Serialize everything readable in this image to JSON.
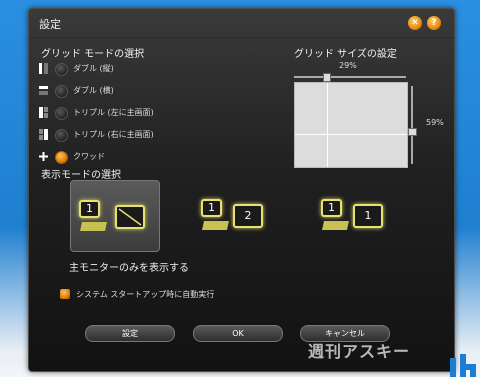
{
  "window": {
    "title": "設定"
  },
  "grid_mode": {
    "heading": "グリッド モードの選択",
    "options": [
      {
        "label": "ダブル (縦)",
        "icon": "grid-double-vertical-icon",
        "selected": false
      },
      {
        "label": "ダブル (横)",
        "icon": "grid-double-horizontal-icon",
        "selected": false
      },
      {
        "label": "トリプル (左に主画面)",
        "icon": "grid-triple-left-icon",
        "selected": false
      },
      {
        "label": "トリプル (右に主画面)",
        "icon": "grid-triple-right-icon",
        "selected": false
      },
      {
        "label": "クワッド",
        "icon": "grid-quad-icon",
        "selected": true
      }
    ]
  },
  "grid_size": {
    "heading": "グリッド サイズの設定",
    "horizontal_percent": "29%",
    "vertical_percent": "59%"
  },
  "display_mode": {
    "heading": "表示モードの選択",
    "caption": "主モニターのみを表示する",
    "modes": [
      {
        "labels": [
          "1",
          ""
        ],
        "selected": true
      },
      {
        "labels": [
          "1",
          "2"
        ],
        "selected": false
      },
      {
        "labels": [
          "1",
          "1"
        ],
        "selected": false
      }
    ]
  },
  "startup": {
    "label": "システム スタートアップ時に自動実行",
    "checked": true
  },
  "buttons": {
    "set": "設定",
    "ok": "OK",
    "cancel": "キャンセル"
  },
  "watermark": "週刊アスキー",
  "colors": {
    "accent": "#e08000",
    "monitor_glow": "#e8e070",
    "background": "#1f7fd0"
  }
}
